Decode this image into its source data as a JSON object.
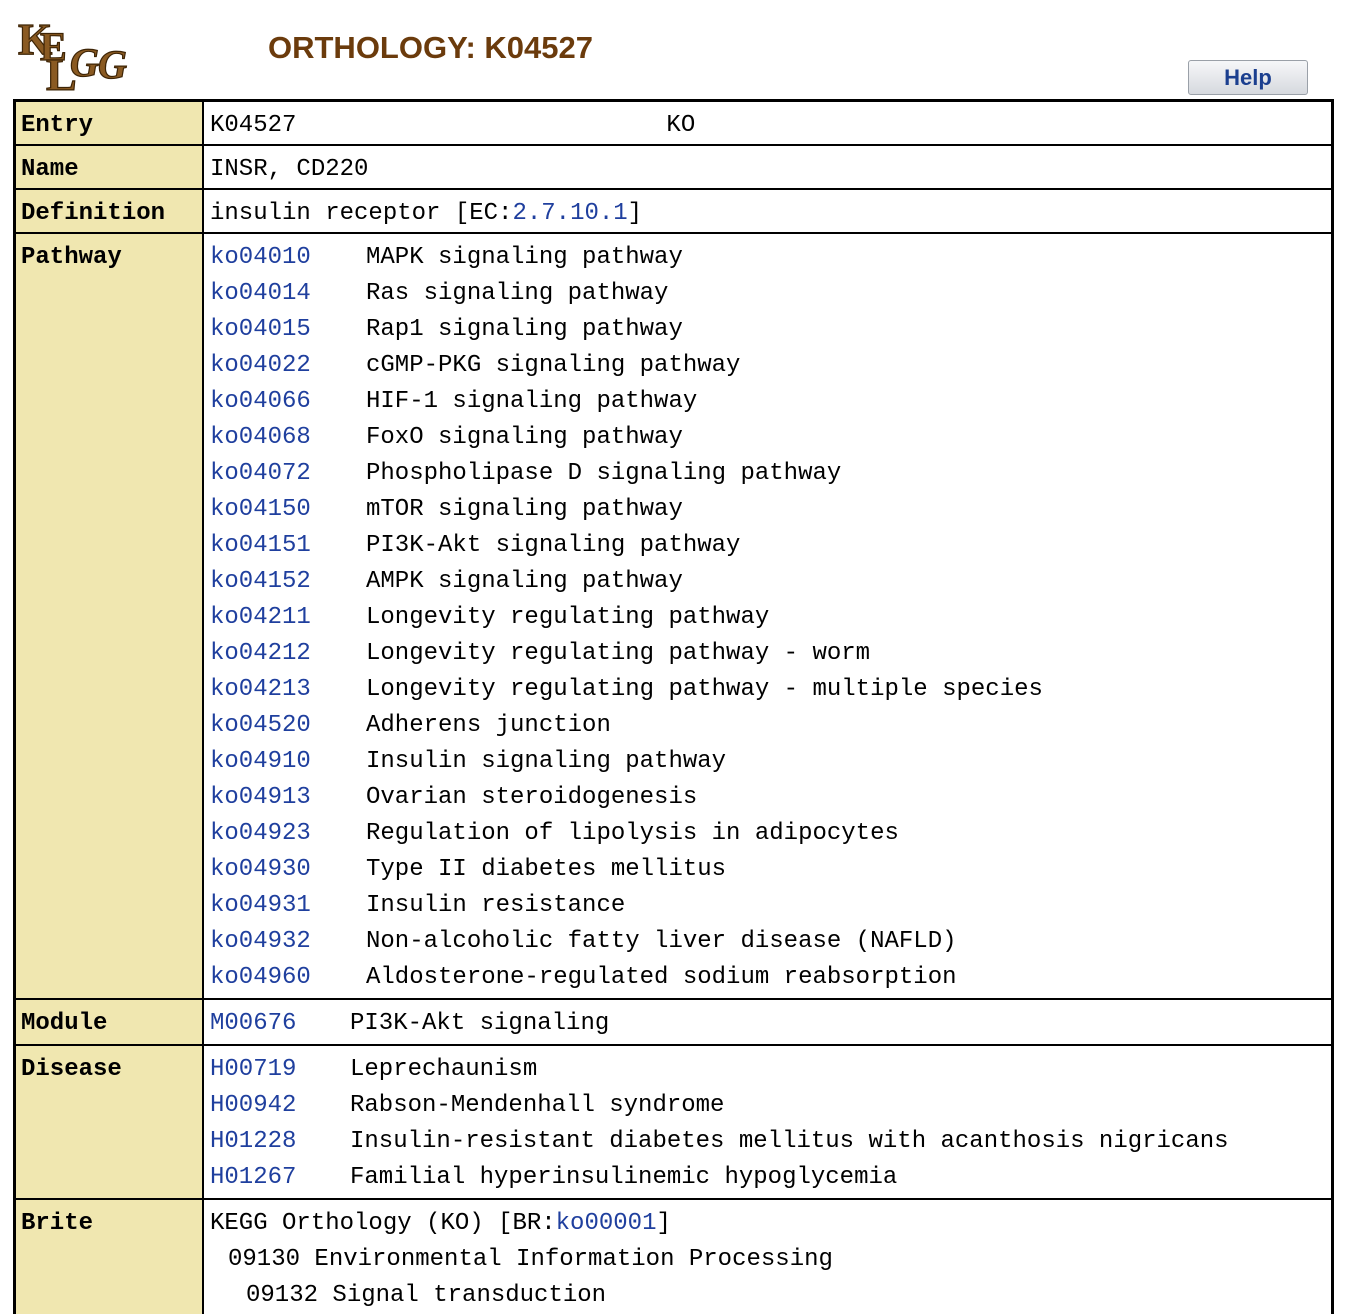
{
  "header": {
    "logo_text": "KEGG",
    "title": "ORTHOLOGY: K04527",
    "help_label": "Help"
  },
  "labels": {
    "entry": "Entry",
    "name": "Name",
    "definition": "Definition",
    "pathway": "Pathway",
    "module": "Module",
    "disease": "Disease",
    "brite": "Brite"
  },
  "entry": {
    "id": "K04527",
    "type": "KO"
  },
  "name": "INSR, CD220",
  "definition": {
    "text": "insulin receptor [EC:",
    "ec": "2.7.10.1",
    "close": "]"
  },
  "pathways": [
    {
      "id": "ko04010",
      "name": "MAPK signaling pathway"
    },
    {
      "id": "ko04014",
      "name": "Ras signaling pathway"
    },
    {
      "id": "ko04015",
      "name": "Rap1 signaling pathway"
    },
    {
      "id": "ko04022",
      "name": "cGMP-PKG signaling pathway"
    },
    {
      "id": "ko04066",
      "name": "HIF-1 signaling pathway"
    },
    {
      "id": "ko04068",
      "name": "FoxO signaling pathway"
    },
    {
      "id": "ko04072",
      "name": "Phospholipase D signaling pathway"
    },
    {
      "id": "ko04150",
      "name": "mTOR signaling pathway"
    },
    {
      "id": "ko04151",
      "name": "PI3K-Akt signaling pathway"
    },
    {
      "id": "ko04152",
      "name": "AMPK signaling pathway"
    },
    {
      "id": "ko04211",
      "name": "Longevity regulating pathway"
    },
    {
      "id": "ko04212",
      "name": "Longevity regulating pathway - worm"
    },
    {
      "id": "ko04213",
      "name": "Longevity regulating pathway - multiple species"
    },
    {
      "id": "ko04520",
      "name": "Adherens junction"
    },
    {
      "id": "ko04910",
      "name": "Insulin signaling pathway"
    },
    {
      "id": "ko04913",
      "name": "Ovarian steroidogenesis"
    },
    {
      "id": "ko04923",
      "name": "Regulation of lipolysis in adipocytes"
    },
    {
      "id": "ko04930",
      "name": "Type II diabetes mellitus"
    },
    {
      "id": "ko04931",
      "name": "Insulin resistance"
    },
    {
      "id": "ko04932",
      "name": "Non-alcoholic fatty liver disease (NAFLD)"
    },
    {
      "id": "ko04960",
      "name": "Aldosterone-regulated sodium reabsorption"
    }
  ],
  "modules": [
    {
      "id": "M00676",
      "name": "PI3K-Akt signaling"
    }
  ],
  "diseases": [
    {
      "id": "H00719",
      "name": "Leprechaunism"
    },
    {
      "id": "H00942",
      "name": "Rabson-Mendenhall syndrome"
    },
    {
      "id": "H01228",
      "name": "Insulin-resistant diabetes mellitus with acanthosis nigricans"
    },
    {
      "id": "H01267",
      "name": "Familial hyperinsulinemic hypoglycemia"
    }
  ],
  "brite": {
    "prefix": "KEGG Orthology (KO) [BR:",
    "link": "ko00001",
    "suffix": "]",
    "level1": "09130 Environmental Information Processing",
    "level2": "09132 Signal transduction"
  },
  "colors": {
    "title": "#6b3b0c",
    "label_bg": "#f0e7b0",
    "link": "#1f3f9e"
  }
}
